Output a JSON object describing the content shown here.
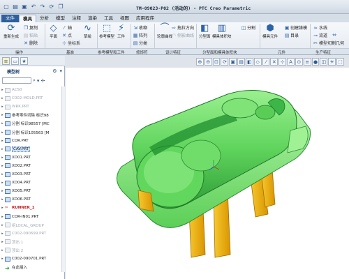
{
  "window": {
    "title": "TM-09023-P02 (活动的) - PTC Creo Parametric"
  },
  "qat_icons": [
    "new-icon",
    "open-icon",
    "save-icon",
    "undo-icon",
    "redo-icon",
    "regenerate-icon",
    "window-icon"
  ],
  "menu_tabs": [
    "文件",
    "模具",
    "分析",
    "模型",
    "注释",
    "渲染",
    "工具",
    "视图",
    "应用程序"
  ],
  "ribbon": {
    "items": {
      "regen": "重新生成",
      "copy": "复制",
      "paste": "粘贴",
      "delete": "删除",
      "axis": "轴",
      "point": "点",
      "coord": "坐标系",
      "plane": "平面",
      "sketch": "草绘",
      "ref_model": "参考模型",
      "workpiece": "工件",
      "shrink": "收缩",
      "pattern": "阵列",
      "category": "分类",
      "profile_curve": "轮廓曲线",
      "drag_dir": "拖拉方向",
      "side_shade": "侧影曲线",
      "parting_face": "分型面",
      "mold_volume": "模具体积块",
      "split": "分割",
      "mold_comp": "模具元件",
      "create_cast": "创建铸模",
      "catalog": "目录",
      "waterline": "水线",
      "runner": "流道",
      "cutoff_geom": "模型切割几何",
      "open_mold": "模具开模"
    },
    "groups": [
      "操作",
      "基准",
      "参考模型和工件",
      "修饰符",
      "设计特征",
      "分型面和模具体积块",
      "元件",
      "生产特征"
    ]
  },
  "model_tree": {
    "title": "模型树",
    "nodes": [
      {
        "label": "ACS0",
        "state": "dim"
      },
      {
        "label": "C002-MOLD.PRT",
        "state": "dim"
      },
      {
        "label": "WRK.PRT",
        "state": "dim"
      },
      {
        "label": "参考零件切除 标识98",
        "state": "normal"
      },
      {
        "label": "分割 标识98557 [MC",
        "state": "normal"
      },
      {
        "label": "分割 标识105563 [M",
        "state": "normal"
      },
      {
        "label": "COR.PRT",
        "state": "normal"
      },
      {
        "label": "CAV.PRT",
        "state": "selected"
      },
      {
        "label": "XD01.PRT",
        "state": "normal"
      },
      {
        "label": "XD02.PRT",
        "state": "normal"
      },
      {
        "label": "XD03.PRT",
        "state": "normal"
      },
      {
        "label": "XD04.PRT",
        "state": "normal"
      },
      {
        "label": "XD05.PRT",
        "state": "normal"
      },
      {
        "label": "XD06.PRT",
        "state": "normal"
      },
      {
        "label": "RUNNER_1",
        "state": "red"
      },
      {
        "label": "COR-IN01.PRT",
        "state": "normal"
      },
      {
        "label": "组LOCAL_GROUP",
        "state": "dim"
      },
      {
        "label": "C002-090699.PRT",
        "state": "dim"
      },
      {
        "label": "顶出 1",
        "state": "dim"
      },
      {
        "label": "顶出 2",
        "state": "dim"
      },
      {
        "label": "C002-090701.PRT",
        "state": "normal"
      },
      {
        "label": "在此插入",
        "state": "insert"
      }
    ]
  },
  "view_toolbar_icons": [
    "zoom-in-icon",
    "zoom-out-icon",
    "refit-icon",
    "repaint-icon",
    "view-manager-icon",
    "saved-views-icon",
    "display-style-icon",
    "datum-planes-icon",
    "datum-axes-icon",
    "datum-points-icon",
    "datum-csys-icon",
    "annotation-icon",
    "spin-center-icon",
    "layers-icon",
    "appearance-icon",
    "section-icon",
    "render-icon",
    "perspective-icon"
  ],
  "colors": {
    "part_green": "#6ee06b",
    "part_dark": "#1f8d2f",
    "pin_orange": "#f0b400",
    "file_tab": "#2f5f9c"
  }
}
